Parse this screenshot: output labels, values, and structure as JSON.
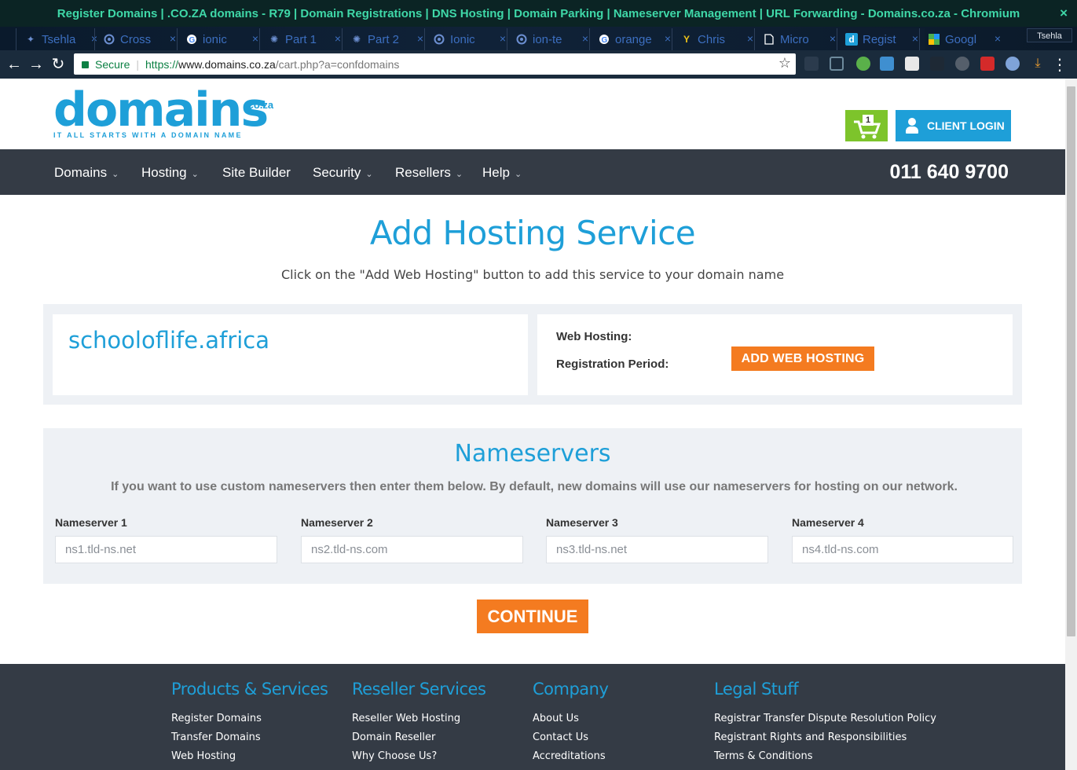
{
  "browser": {
    "window_title": "Register Domains | .CO.ZA domains - R79 | Domain Registrations | DNS Hosting | Domain Parking | Nameserver Management | URL Forwarding - Domains.co.za - Chromium",
    "close_glyph": "×",
    "profile_name": "Tsehla",
    "tabs": [
      {
        "label": "Tsehla",
        "icon": "star-favicon-icon"
      },
      {
        "label": "Cross",
        "icon": "circle-favicon-icon"
      },
      {
        "label": "ionic",
        "icon": "google-favicon-icon"
      },
      {
        "label": "Part 1",
        "icon": "tile-favicon-icon"
      },
      {
        "label": "Part 2",
        "icon": "tile-favicon-icon"
      },
      {
        "label": "Ionic",
        "icon": "circle-favicon-icon"
      },
      {
        "label": "ion-te",
        "icon": "circle-favicon-icon"
      },
      {
        "label": "orange",
        "icon": "google-favicon-icon"
      },
      {
        "label": "Chris",
        "icon": "y-favicon-icon"
      },
      {
        "label": "Micro",
        "icon": "page-favicon-icon"
      },
      {
        "label": "Regist",
        "icon": "d-favicon-icon",
        "active": true
      },
      {
        "label": "Googl",
        "icon": "maps-favicon-icon"
      }
    ],
    "address": {
      "secure_label": "Secure",
      "separator": "|",
      "protocol": "https://",
      "host": "www.domains.co.za",
      "path": "/cart.php?a=confdomains"
    }
  },
  "header": {
    "logo_word": "domains",
    "logo_tld": ".co.za",
    "logo_tagline": "IT ALL STARTS WITH A DOMAIN NAME",
    "cart_count": "1",
    "login_label": "CLIENT LOGIN"
  },
  "nav": {
    "items": [
      "Domains",
      "Hosting",
      "Site Builder",
      "Security",
      "Resellers",
      "Help"
    ],
    "phone": "011 640 9700"
  },
  "main": {
    "title": "Add Hosting Service",
    "intro": "Click on the \"Add Web Hosting\" button to add this service to your domain name",
    "domain_name": "schooloflife.africa",
    "web_hosting_label": "Web Hosting:",
    "registration_period_label": "Registration Period:",
    "add_web_hosting_label": "ADD WEB HOSTING"
  },
  "nameservers": {
    "title": "Nameservers",
    "description": "If you want to use custom nameservers then enter them below. By default, new domains will use our nameservers for hosting on our network.",
    "fields": [
      {
        "label": "Nameserver 1",
        "placeholder": "ns1.tld-ns.net"
      },
      {
        "label": "Nameserver 2",
        "placeholder": "ns2.tld-ns.com"
      },
      {
        "label": "Nameserver 3",
        "placeholder": "ns3.tld-ns.net"
      },
      {
        "label": "Nameserver 4",
        "placeholder": "ns4.tld-ns.com"
      }
    ],
    "continue_label": "CONTINUE"
  },
  "footer": {
    "columns": [
      {
        "heading": "Products & Services",
        "links": [
          "Register Domains",
          "Transfer Domains",
          "Web Hosting"
        ]
      },
      {
        "heading": "Reseller Services",
        "links": [
          "Reseller Web Hosting",
          "Domain Reseller",
          "Why Choose Us?"
        ]
      },
      {
        "heading": "Company",
        "links": [
          "About Us",
          "Contact Us",
          "Accreditations"
        ]
      },
      {
        "heading": "Legal Stuff",
        "links": [
          "Registrar Transfer Dispute Resolution Policy",
          "Registrant Rights and Responsibilities",
          "Terms & Conditions"
        ]
      }
    ]
  },
  "colors": {
    "brand_blue": "#1e9fd8",
    "accent_orange": "#f47b20",
    "cart_green": "#7dc42b",
    "nav_dark": "#343b45"
  }
}
